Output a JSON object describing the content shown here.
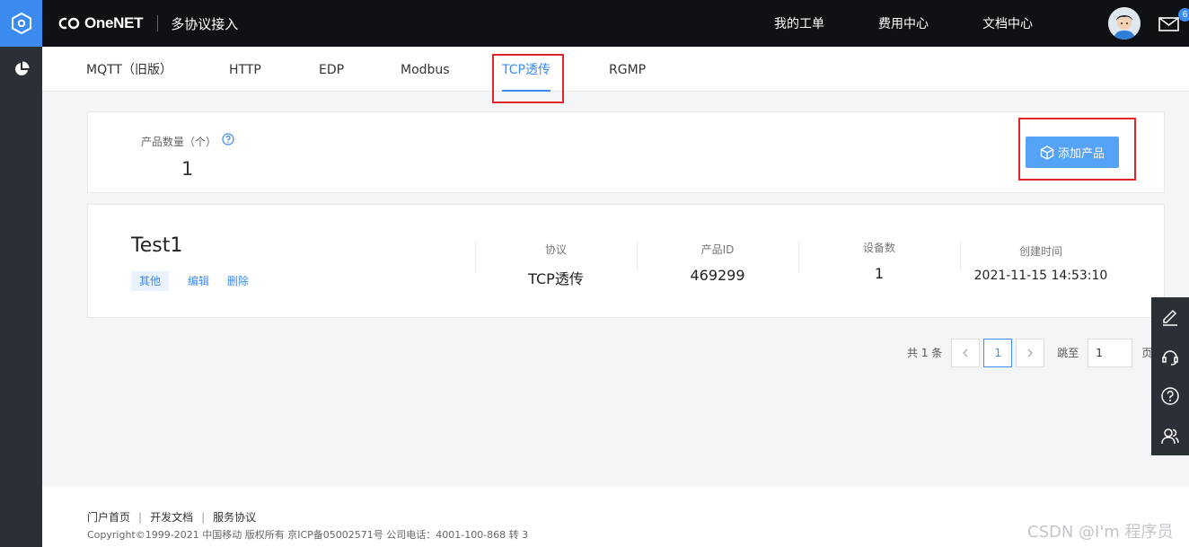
{
  "header": {
    "logo_text": "OneNET",
    "title": "多协议接入",
    "nav": [
      "我的工单",
      "费用中心",
      "文档中心"
    ],
    "mail_badge": "6"
  },
  "tabs": [
    {
      "label": "MQTT（旧版）"
    },
    {
      "label": "HTTP"
    },
    {
      "label": "EDP"
    },
    {
      "label": "Modbus"
    },
    {
      "label": "TCP透传",
      "active": true
    },
    {
      "label": "RGMP"
    }
  ],
  "summary": {
    "count_label": "产品数量（个）",
    "count_value": "1",
    "add_button_label": "添加产品"
  },
  "product": {
    "name": "Test1",
    "tag": "其他",
    "edit_label": "编辑",
    "delete_label": "删除",
    "columns": [
      {
        "label": "协议",
        "value": "TCP透传"
      },
      {
        "label": "产品ID",
        "value": "469299"
      },
      {
        "label": "设备数",
        "value": "1"
      },
      {
        "label": "创建时间",
        "value": "2021-11-15 14:53:10"
      }
    ]
  },
  "pagination": {
    "total_text": "共 1 条",
    "current_page": "1",
    "jump_label": "跳至",
    "jump_value": "1",
    "page_suffix": "页"
  },
  "footer": {
    "links": [
      "门户首页",
      "开发文档",
      "服务协议"
    ],
    "copyright": "Copyright©1999-2021 中国移动 版权所有 京ICP备05002571号 公司电话：4001-100-868 转 3"
  },
  "watermark": "CSDN @I'm 程序员",
  "colors": {
    "accent": "#3b8bf0",
    "header_bg": "#0f1115",
    "rail_bg": "#2b2f36",
    "highlight_box": "#e0262b"
  },
  "icons": {
    "rail_top": "hexagon-logo-icon",
    "rail_item": "pie-chart-icon",
    "help": "question-circle-icon",
    "add": "cube-icon",
    "float": [
      "pencil-icon",
      "headset-icon",
      "question-icon",
      "users-icon"
    ]
  }
}
